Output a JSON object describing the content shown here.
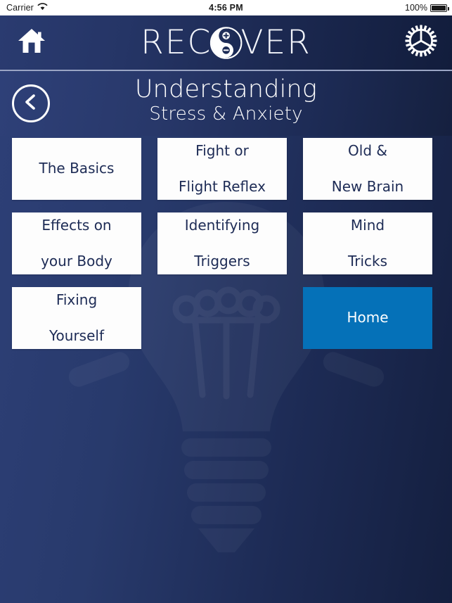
{
  "statusbar": {
    "carrier": "Carrier",
    "wifi_icon": "wifi-icon",
    "time": "4:56 PM",
    "battery_percent": "100%",
    "battery_icon": "battery-full-icon"
  },
  "navbar": {
    "home_icon": "home-icon",
    "gear_icon": "gear-icon",
    "logo_part1": "REC",
    "logo_mark": "yin-yang-plus-minus-icon",
    "logo_part2": "VER",
    "logo_full": "RECOVER"
  },
  "pagehead": {
    "back_icon": "chevron-left-circle-icon",
    "title": "Understanding",
    "subtitle": "Stress & Anxiety"
  },
  "background": {
    "watermark_icon": "lightbulb-idea-icon"
  },
  "menu": {
    "tiles": [
      {
        "line1": "The Basics",
        "line2": "",
        "style": "white"
      },
      {
        "line1": "Fight or",
        "line2": "Flight Reflex",
        "style": "white"
      },
      {
        "line1": "Old &",
        "line2": "New Brain",
        "style": "white"
      },
      {
        "line1": "Effects on",
        "line2": "your Body",
        "style": "white"
      },
      {
        "line1": "Identifying",
        "line2": "Triggers",
        "style": "white"
      },
      {
        "line1": "Mind",
        "line2": "Tricks",
        "style": "white"
      },
      {
        "line1": "Fixing",
        "line2": "Yourself",
        "style": "white"
      },
      {
        "line1": "",
        "line2": "",
        "style": "empty"
      },
      {
        "line1": "Home",
        "line2": "",
        "style": "accent"
      }
    ]
  },
  "colors": {
    "accent_blue": "#0571b8",
    "bg_light": "#2d3f76",
    "bg_dark": "#141f3f",
    "tile_bg": "#fdfdfd",
    "tile_text": "#1d2b55"
  }
}
